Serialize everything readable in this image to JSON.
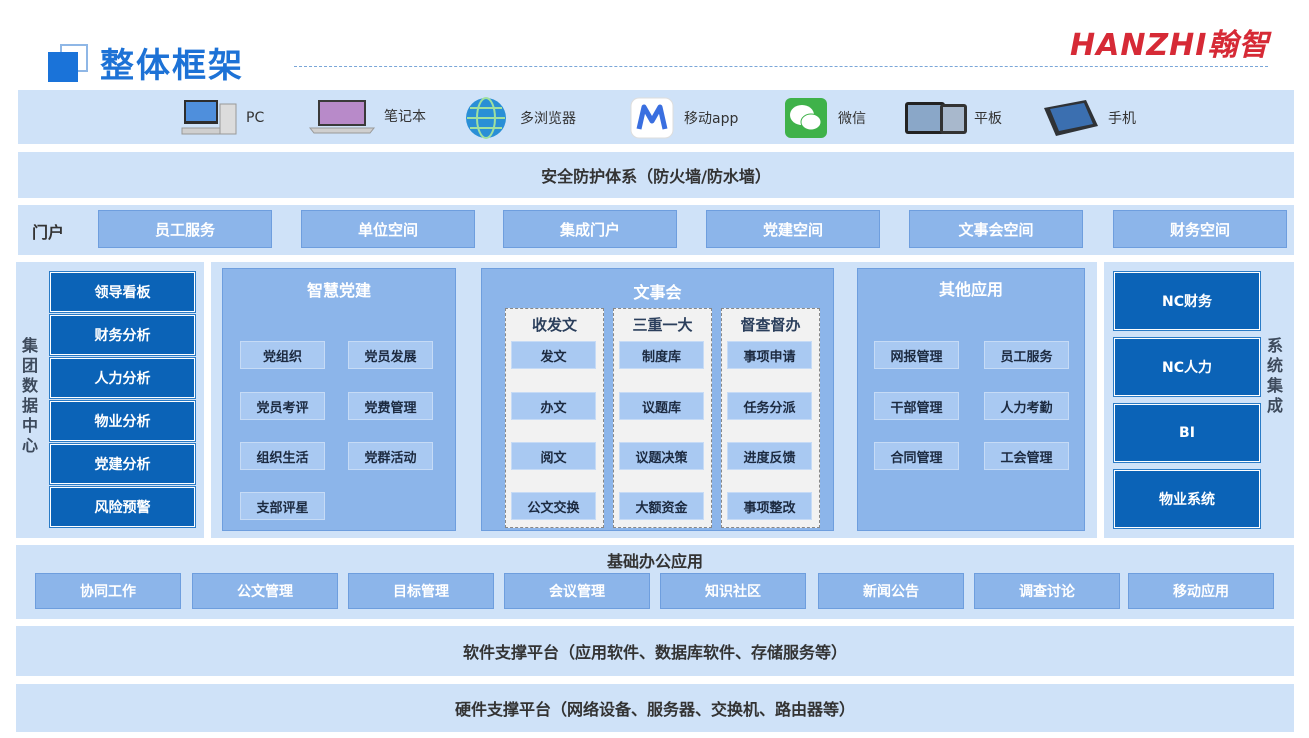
{
  "header": {
    "title": "整体框架",
    "brand": "HANZHI翰智"
  },
  "devices": [
    {
      "label": "PC",
      "icon": "pc-icon"
    },
    {
      "label": "笔记本",
      "icon": "laptop-icon"
    },
    {
      "label": "多浏览器",
      "icon": "globe-icon"
    },
    {
      "label": "移动app",
      "icon": "app-icon"
    },
    {
      "label": "微信",
      "icon": "wechat-icon"
    },
    {
      "label": "平板",
      "icon": "tablet-icon"
    },
    {
      "label": "手机",
      "icon": "phone-icon"
    }
  ],
  "security": "安全防护体系（防火墙/防水墙）",
  "portal": {
    "label": "门户",
    "items": [
      "员工服务",
      "单位空间",
      "集成门户",
      "党建空间",
      "文事会空间",
      "财务空间"
    ]
  },
  "data_center": {
    "label": "集团数据中心",
    "items": [
      "领导看板",
      "财务分析",
      "人力分析",
      "物业分析",
      "党建分析",
      "风险预警"
    ]
  },
  "party": {
    "title": "智慧党建",
    "items": [
      "党组织",
      "党员发展",
      "党员考评",
      "党费管理",
      "组织生活",
      "党群活动",
      "支部评星"
    ]
  },
  "council": {
    "title": "文事会",
    "columns": [
      {
        "title": "收发文",
        "items": [
          "发文",
          "办文",
          "阅文",
          "公文交换"
        ]
      },
      {
        "title": "三重一大",
        "items": [
          "制度库",
          "议题库",
          "议题决策",
          "大额资金"
        ]
      },
      {
        "title": "督查督办",
        "items": [
          "事项申请",
          "任务分派",
          "进度反馈",
          "事项整改"
        ]
      }
    ]
  },
  "other": {
    "title": "其他应用",
    "items": [
      "网报管理",
      "员工服务",
      "干部管理",
      "人力考勤",
      "合同管理",
      "工会管理"
    ]
  },
  "integration": {
    "label": "系统集成",
    "items": [
      "NC财务",
      "NC人力",
      "BI",
      "物业系统"
    ]
  },
  "basic": {
    "title": "基础办公应用",
    "items": [
      "协同工作",
      "公文管理",
      "目标管理",
      "会议管理",
      "知识社区",
      "新闻公告",
      "调查讨论",
      "移动应用"
    ]
  },
  "software": "软件支撑平台（应用软件、数据库软件、存储服务等）",
  "hardware": "硬件支撑平台（网络设备、服务器、交换机、路由器等）"
}
